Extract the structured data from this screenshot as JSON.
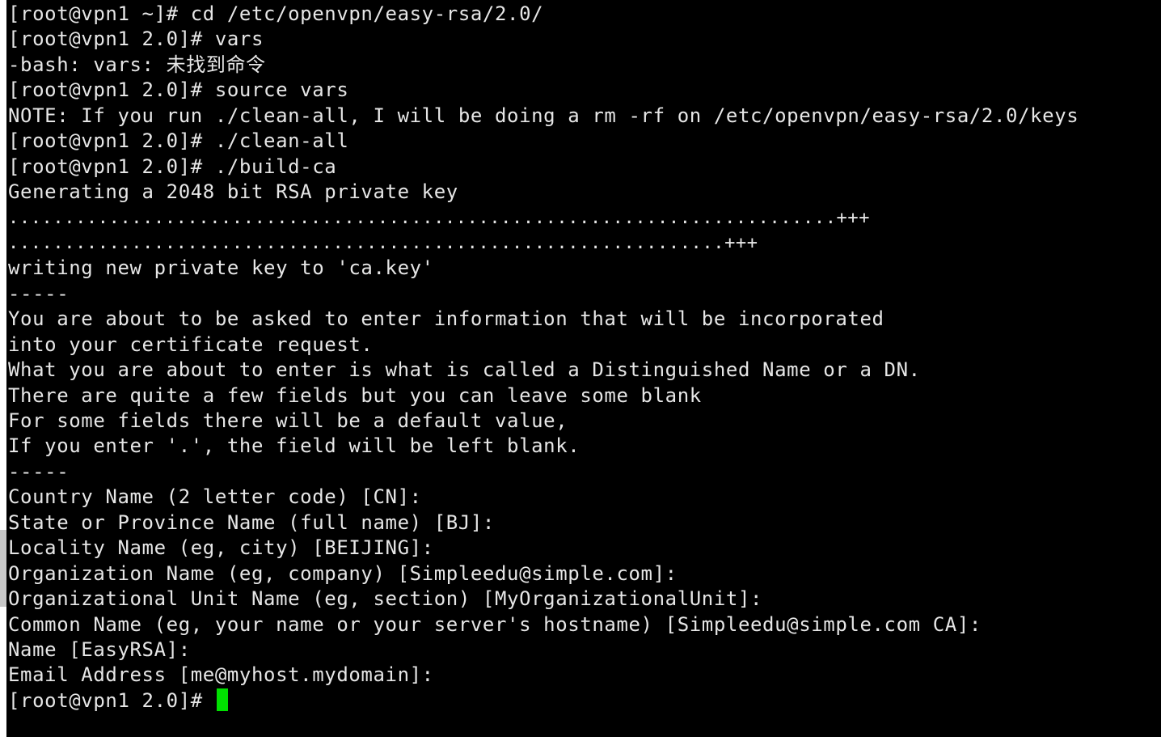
{
  "terminal": {
    "lines": [
      "[root@vpn1 ~]# cd /etc/openvpn/easy-rsa/2.0/",
      "[root@vpn1 2.0]# vars",
      "-bash: vars: 未找到命令",
      "[root@vpn1 2.0]# source vars",
      "NOTE: If you run ./clean-all, I will be doing a rm -rf on /etc/openvpn/easy-rsa/2.0/keys",
      "[root@vpn1 2.0]# ./clean-all",
      "[root@vpn1 2.0]# ./build-ca",
      "Generating a 2048 bit RSA private key",
      "..........................................................................+++",
      "................................................................+++",
      "writing new private key to 'ca.key'",
      "-----",
      "You are about to be asked to enter information that will be incorporated",
      "into your certificate request.",
      "What you are about to enter is what is called a Distinguished Name or a DN.",
      "There are quite a few fields but you can leave some blank",
      "For some fields there will be a default value,",
      "If you enter '.', the field will be left blank.",
      "-----",
      "Country Name (2 letter code) [CN]:",
      "State or Province Name (full name) [BJ]:",
      "Locality Name (eg, city) [BEIJING]:",
      "Organization Name (eg, company) [Simpleedu@simple.com]:",
      "Organizational Unit Name (eg, section) [MyOrganizationalUnit]:",
      "Common Name (eg, your name or your server's hostname) [Simpleedu@simple.com CA]:",
      "Name [EasyRSA]:",
      "Email Address [me@myhost.mydomain]:"
    ],
    "prompt": "[root@vpn1 2.0]# "
  },
  "colors": {
    "background": "#000000",
    "text": "#e6e6e6",
    "cursor": "#00e000"
  }
}
